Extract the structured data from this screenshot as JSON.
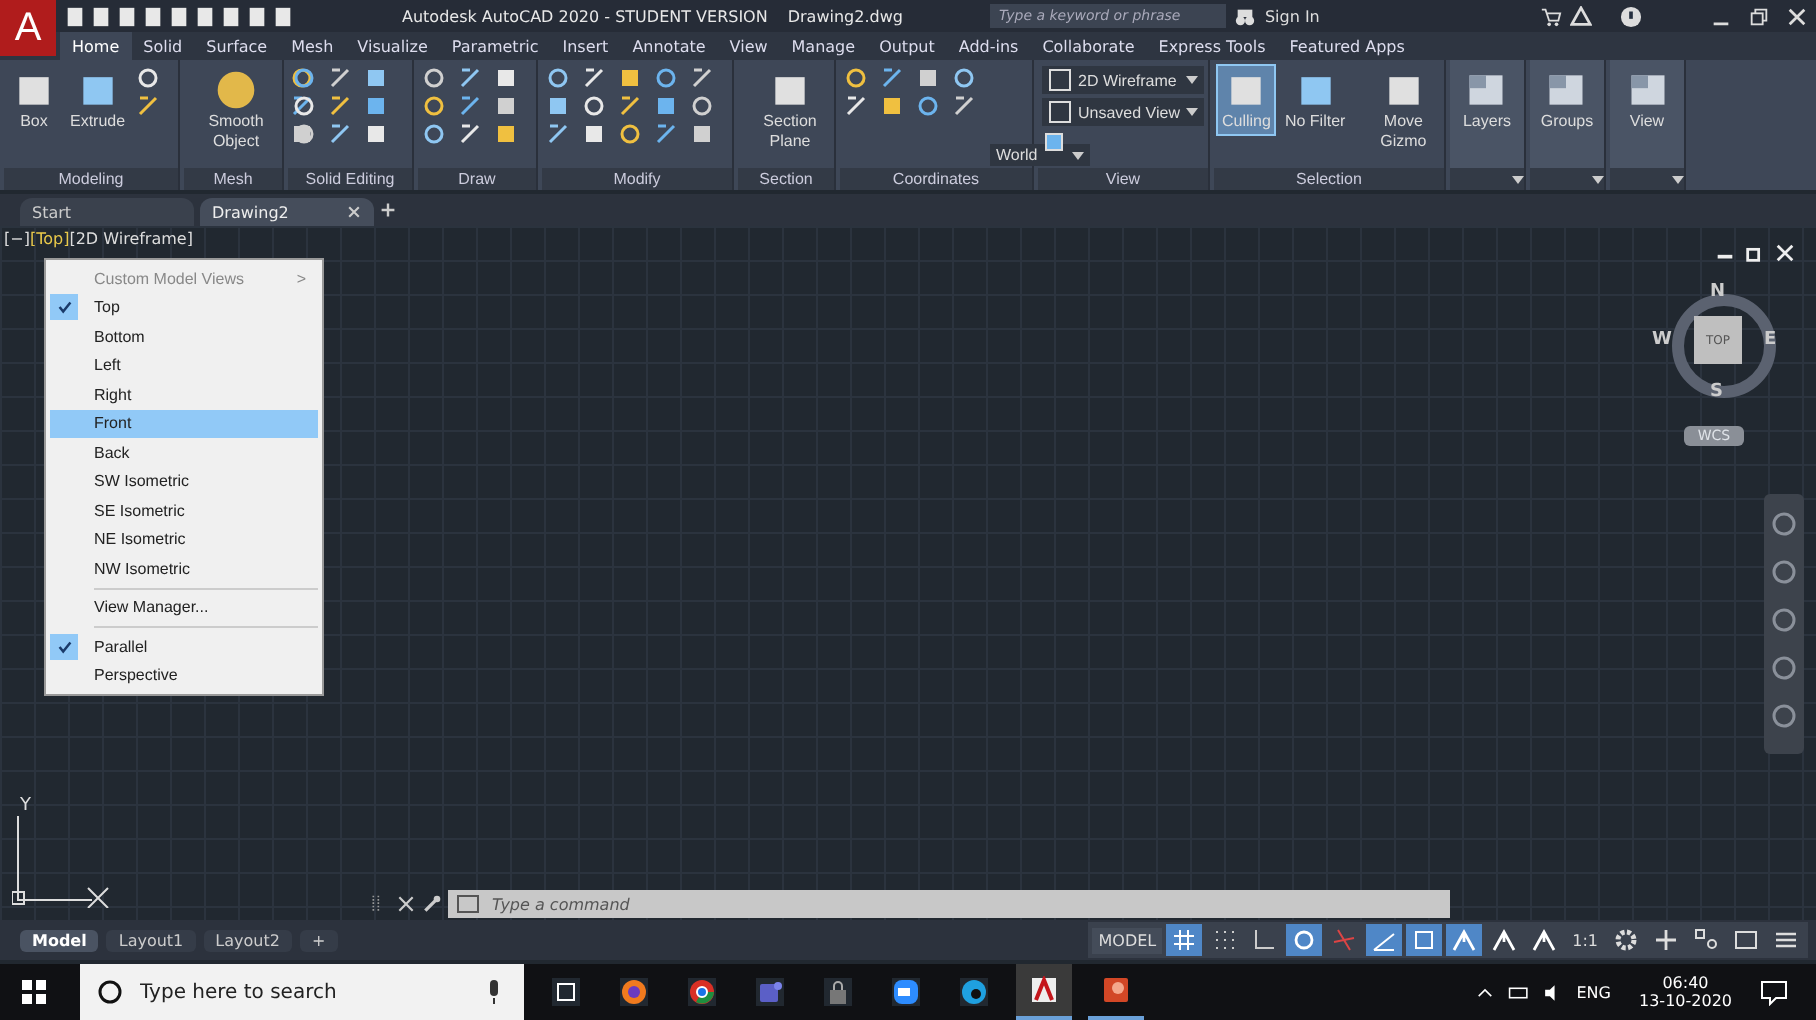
{
  "app_button": {
    "letter": "A"
  },
  "title_bar": {
    "title": "Autodesk AutoCAD 2020 - STUDENT VERSION",
    "file": "Drawing2.dwg",
    "search": {
      "placeholder": "Type a keyword or phrase"
    },
    "sign_in": "Sign In"
  },
  "ribbon_tabs": [
    {
      "label": "Home",
      "selected": true
    },
    {
      "label": "Solid",
      "selected": false
    },
    {
      "label": "Surface",
      "selected": false
    },
    {
      "label": "Mesh",
      "selected": false
    },
    {
      "label": "Visualize",
      "selected": false
    },
    {
      "label": "Parametric",
      "selected": false
    },
    {
      "label": "Insert",
      "selected": false
    },
    {
      "label": "Annotate",
      "selected": false
    },
    {
      "label": "View",
      "selected": false
    },
    {
      "label": "Manage",
      "selected": false
    },
    {
      "label": "Output",
      "selected": false
    },
    {
      "label": "Add-ins",
      "selected": false
    },
    {
      "label": "Collaborate",
      "selected": false
    },
    {
      "label": "Express Tools",
      "selected": false
    },
    {
      "label": "Featured Apps",
      "selected": false
    }
  ],
  "panels": [
    {
      "title": "Modeling",
      "kind": "tools",
      "buttons": [
        {
          "label": "Box",
          "active": false
        },
        {
          "label": "Extrude",
          "active": false
        }
      ]
    },
    {
      "title": "Mesh",
      "kind": "tools",
      "buttons": [
        {
          "label": "Smooth Object",
          "active": false
        }
      ]
    },
    {
      "title": "Solid Editing",
      "kind": "tools"
    },
    {
      "title": "Draw",
      "kind": "tools"
    },
    {
      "title": "Modify",
      "kind": "tools"
    },
    {
      "title": "Section",
      "kind": "tools",
      "buttons": [
        {
          "label": "Section Plane",
          "active": false
        }
      ]
    },
    {
      "title": "Coordinates",
      "kind": "coords",
      "dropdowns": [
        "World"
      ]
    },
    {
      "title": "View",
      "kind": "view",
      "dropdowns": [
        "2D Wireframe",
        "Unsaved View"
      ]
    },
    {
      "title": "Selection",
      "kind": "tools",
      "buttons": [
        {
          "label": "Culling",
          "active": true
        },
        {
          "label": "No Filter",
          "active": false
        },
        {
          "label": "Move Gizmo",
          "active": false
        }
      ]
    },
    {
      "title": "Layers",
      "kind": "collapsed"
    },
    {
      "title": "Groups",
      "kind": "collapsed"
    },
    {
      "title": "View",
      "kind": "collapsed"
    }
  ],
  "doc_tabs": [
    {
      "label": "Start",
      "selected": false
    },
    {
      "label": "Drawing2",
      "selected": true
    }
  ],
  "viewport_controls": [
    {
      "label": "[−]",
      "highlighted": false
    },
    {
      "label": "[Top]",
      "highlighted": true
    },
    {
      "label": "[2D Wireframe]",
      "highlighted": false
    }
  ],
  "context_menu": [
    {
      "kind": "header",
      "label": "Custom Model Views",
      "arrow": ">"
    },
    {
      "kind": "item",
      "label": "Top",
      "checked": true,
      "selected": false
    },
    {
      "kind": "item",
      "label": "Bottom",
      "checked": false,
      "selected": false
    },
    {
      "kind": "item",
      "label": "Left",
      "checked": false,
      "selected": false
    },
    {
      "kind": "item",
      "label": "Right",
      "checked": false,
      "selected": false
    },
    {
      "kind": "item",
      "label": "Front",
      "checked": false,
      "selected": true
    },
    {
      "kind": "item",
      "label": "Back",
      "checked": false,
      "selected": false
    },
    {
      "kind": "item",
      "label": "SW Isometric",
      "checked": false,
      "selected": false
    },
    {
      "kind": "item",
      "label": "SE Isometric",
      "checked": false,
      "selected": false
    },
    {
      "kind": "item",
      "label": "NE Isometric",
      "checked": false,
      "selected": false
    },
    {
      "kind": "item",
      "label": "NW Isometric",
      "checked": false,
      "selected": false
    },
    {
      "kind": "separator"
    },
    {
      "kind": "item",
      "label": "View Manager...",
      "checked": false,
      "selected": false
    },
    {
      "kind": "separator"
    },
    {
      "kind": "item",
      "label": "Parallel",
      "checked": true,
      "selected": false
    },
    {
      "kind": "item",
      "label": "Perspective",
      "checked": false,
      "selected": false
    }
  ],
  "view_cube": {
    "north": "N",
    "south": "S",
    "east": "E",
    "west": "W",
    "face": "TOP",
    "ucs": "WCS"
  },
  "ucs_axis": {
    "y": "Y"
  },
  "command_line": {
    "placeholder": "Type a command"
  },
  "layout_tabs": [
    {
      "label": "Model",
      "selected": true
    },
    {
      "label": "Layout1",
      "selected": false
    },
    {
      "label": "Layout2",
      "selected": false
    }
  ],
  "layout_add": "+",
  "status_bar": {
    "model": "MODEL",
    "scale": "1:1",
    "toggles": [
      {
        "kind": "grid",
        "on": true
      },
      {
        "kind": "snap",
        "on": false
      },
      {
        "kind": "ortho",
        "on": false
      },
      {
        "kind": "polar",
        "on": true
      },
      {
        "kind": "iso",
        "on": false
      },
      {
        "kind": "track",
        "on": true
      },
      {
        "kind": "osnap",
        "on": true
      },
      {
        "kind": "annot",
        "on": true
      },
      {
        "kind": "annot",
        "on": false
      },
      {
        "kind": "annot",
        "on": false
      }
    ]
  },
  "taskbar": {
    "search": {
      "placeholder": "Type here to search"
    },
    "language": "ENG",
    "time": "06:40",
    "date": "13-10-2020"
  }
}
